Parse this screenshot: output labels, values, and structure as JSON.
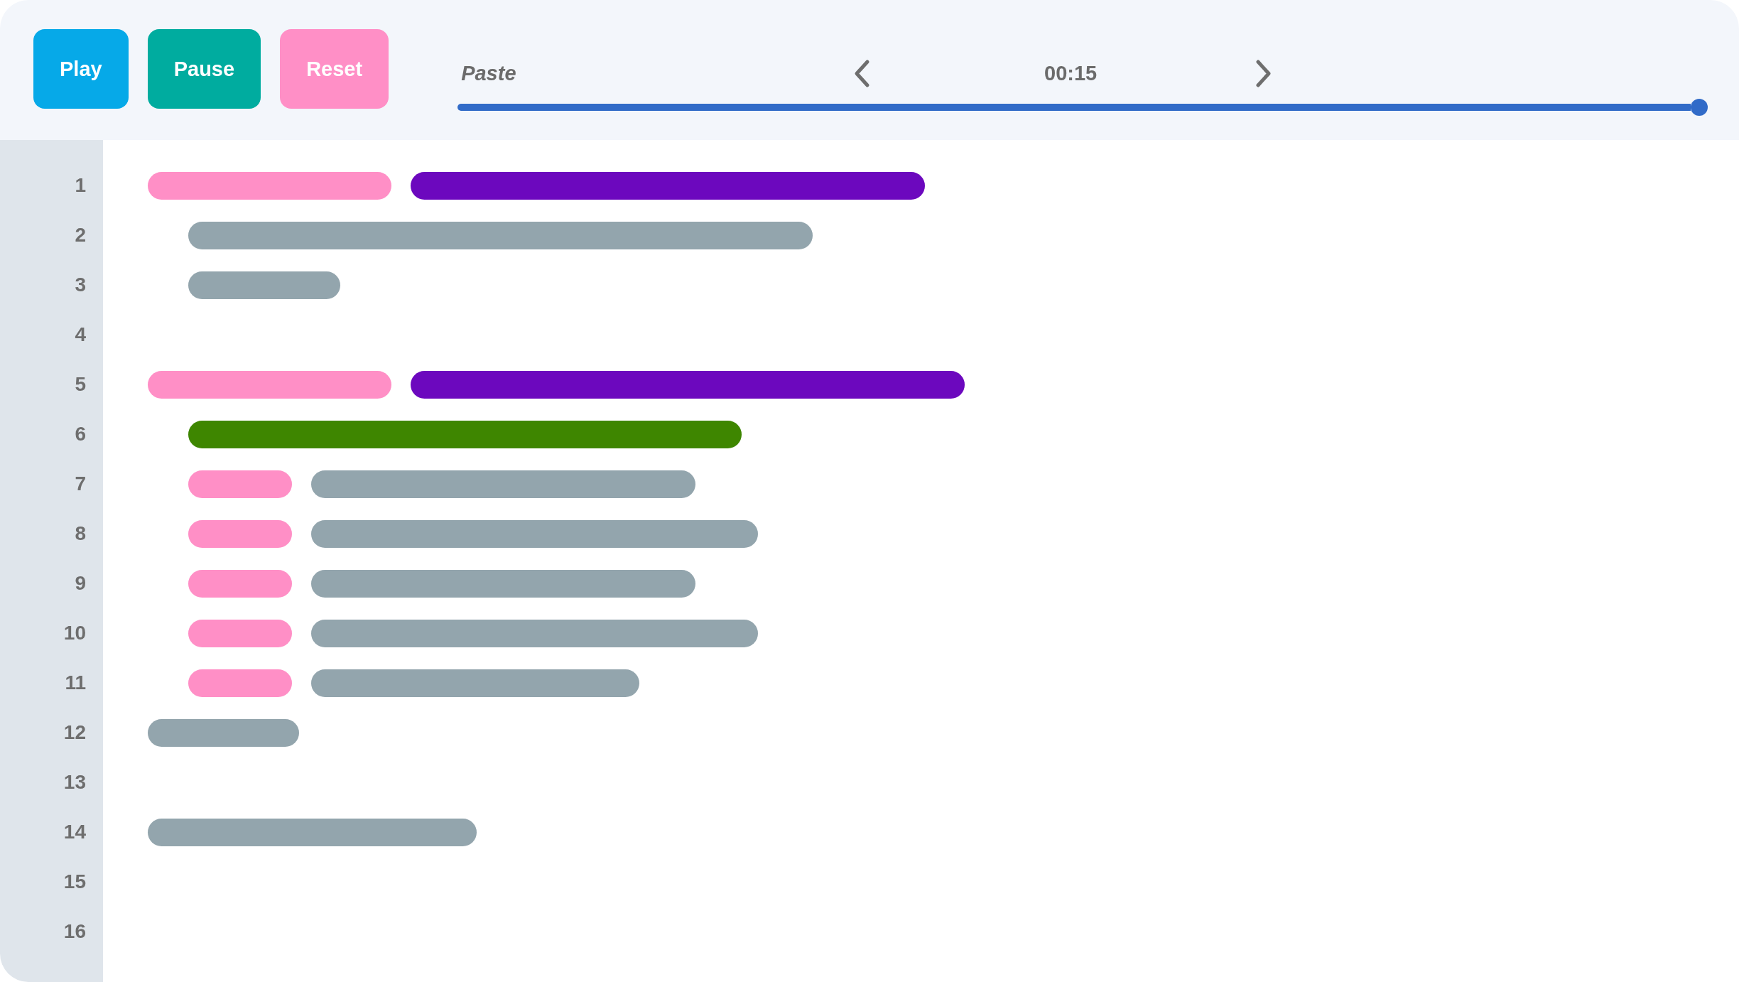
{
  "toolbar": {
    "buttons": [
      {
        "label": "Play",
        "color": "#06a9e8"
      },
      {
        "label": "Pause",
        "color": "#00ac9f"
      },
      {
        "label": "Reset",
        "color": "#ff8fc6"
      }
    ]
  },
  "timeline": {
    "step_label": "Paste",
    "time": "00:15",
    "slider": {
      "level": 1
    }
  },
  "editor": {
    "lines": [
      {
        "number": "1",
        "tokens": [
          {
            "color": "#ff8fc6"
          },
          {
            "color": "#6c08be"
          }
        ],
        "children": [
          {
            "number": "2",
            "tokens": [
              {
                "color": "#93a5ad"
              }
            ]
          },
          {
            "number": "3",
            "tokens": [
              {
                "color": "#93a5ad"
              }
            ]
          }
        ]
      },
      {
        "number": "4"
      },
      {
        "number": "5",
        "tokens": [
          {
            "color": "#ff8fc6"
          },
          {
            "color": "#6c08be"
          }
        ],
        "children": [
          {
            "number": "6",
            "tokens": [
              {
                "color": "#3e8600"
              }
            ]
          },
          {
            "number": "7",
            "tokens": [
              {
                "color": "#ff8fc6"
              },
              {
                "color": "#93a5ad"
              }
            ]
          },
          {
            "number": "8",
            "tokens": [
              {
                "color": "#ff8fc6"
              },
              {
                "color": "#93a5ad"
              }
            ]
          },
          {
            "number": "9",
            "tokens": [
              {
                "color": "#ff8fc6"
              },
              {
                "color": "#93a5ad"
              }
            ]
          },
          {
            "number": "10",
            "tokens": [
              {
                "color": "#ff8fc6"
              },
              {
                "color": "#93a5ad"
              }
            ]
          },
          {
            "number": "11",
            "tokens": [
              {
                "color": "#ff8fc6"
              },
              {
                "color": "#93a5ad"
              }
            ]
          }
        ]
      },
      {
        "number": "12",
        "tokens": [
          {
            "color": "#93a5ad"
          }
        ]
      },
      {
        "number": "13"
      },
      {
        "number": "14",
        "tokens": [
          {
            "color": "#93a5ad"
          }
        ]
      },
      {
        "number": "15"
      },
      {
        "number": "16"
      }
    ]
  }
}
